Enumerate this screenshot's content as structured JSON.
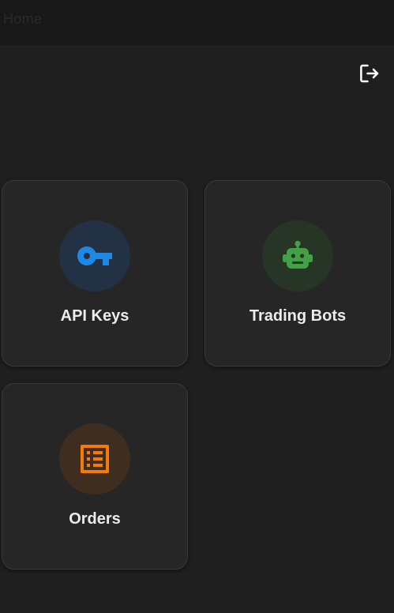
{
  "app": {
    "title": "Home"
  },
  "header": {
    "logout_icon": "logout-icon"
  },
  "cards": [
    {
      "label": "API Keys",
      "icon": "key-icon",
      "accent": "#1e88e5"
    },
    {
      "label": "Trading Bots",
      "icon": "robot-icon",
      "accent": "#43a047"
    },
    {
      "label": "Orders",
      "icon": "list-alt-icon",
      "accent": "#f57c00"
    }
  ]
}
